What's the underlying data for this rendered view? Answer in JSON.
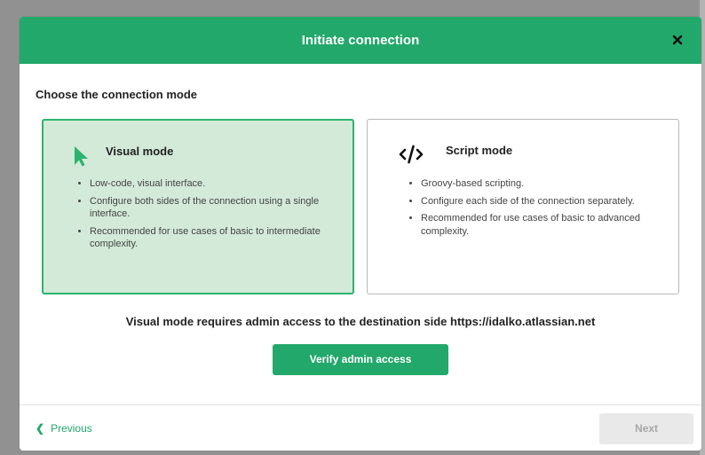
{
  "modal": {
    "title": "Initiate connection",
    "close_icon": "close-icon",
    "section_title": "Choose the connection mode"
  },
  "modes": {
    "visual": {
      "icon": "cursor-arrow-icon",
      "title": "Visual mode",
      "selected": true,
      "bullets": [
        "Low-code, visual interface.",
        "Configure both sides of the connection using a single interface.",
        "Recommended for use cases of basic to intermediate complexity."
      ]
    },
    "script": {
      "icon": "code-icon",
      "title": "Script mode",
      "selected": false,
      "bullets": [
        "Groovy-based scripting.",
        "Configure each side of the connection separately.",
        "Recommended for use cases of basic to advanced complexity."
      ]
    }
  },
  "notice": "Visual mode requires admin access to the destination side https://idalko.atlassian.net",
  "verify_button": "Verify admin access",
  "footer": {
    "previous": "Previous",
    "next": "Next",
    "next_enabled": false
  },
  "colors": {
    "accent": "#22a86a",
    "selected_card_bg": "#d3ead8",
    "disabled_button_bg": "#e9e9e9"
  }
}
